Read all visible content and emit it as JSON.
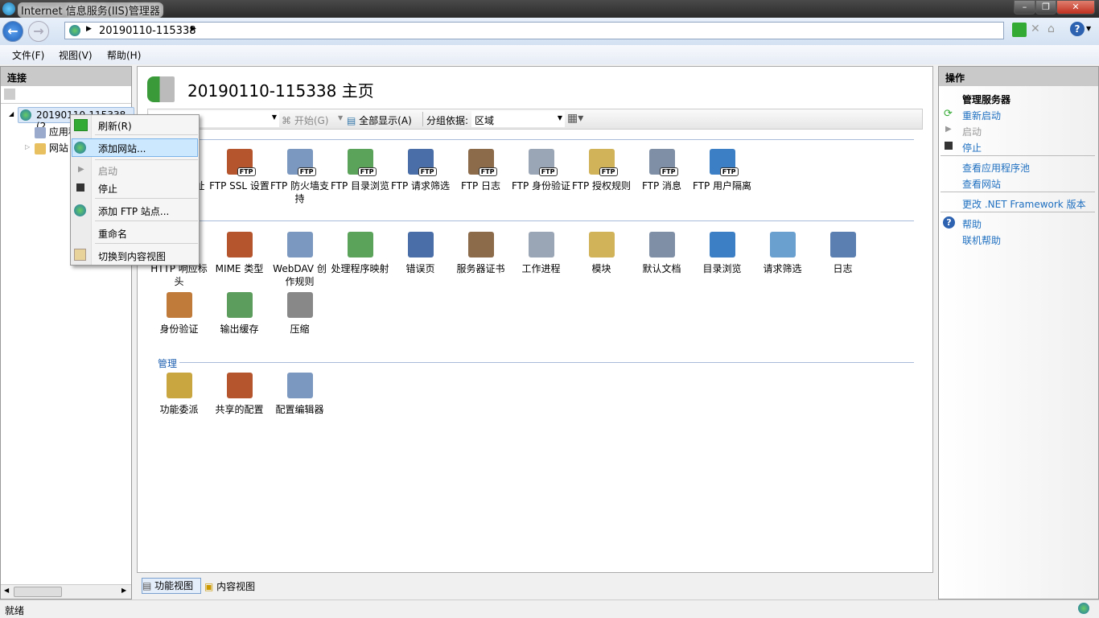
{
  "window": {
    "title": "Internet 信息服务(IIS)管理器"
  },
  "address": {
    "crumb": "20190110-115338"
  },
  "menu": [
    "文件(F)",
    "视图(V)",
    "帮助(H)"
  ],
  "left": {
    "header": "连接",
    "tree": {
      "root": "20190110-115338 (2",
      "children": [
        "应用程序池",
        "网站"
      ]
    }
  },
  "context_menu": {
    "items": [
      "刷新(R)",
      "添加网站...",
      "启动",
      "停止",
      "添加 FTP 站点...",
      "重命名",
      "切换到内容视图"
    ],
    "highlighted": "添加网站...",
    "disabled": [
      "启动"
    ]
  },
  "center": {
    "title": "20190110-115338 主页",
    "toolbar": {
      "filter_value": "",
      "start": "开始(G)",
      "show_all": "全部显示(A)",
      "group_by_label": "分组依据:",
      "group_by_value": "区域"
    },
    "groups": [
      {
        "name": "管理",
        "items": [
          "功能委派",
          "共享的配置",
          "配置编辑器"
        ]
      }
    ],
    "ftp_items": [
      "FTP IP 地址和域限制",
      "FTP SSL 设置",
      "FTP 防火墙支持",
      "FTP 目录浏览",
      "FTP 请求筛选",
      "FTP 日志",
      "FTP 身份验证",
      "FTP 授权规则",
      "FTP 消息",
      "FTP 用户隔离"
    ],
    "iis_items": [
      "HTTP 响应标头",
      "MIME 类型",
      "WebDAV 创作规则",
      "处理程序映射",
      "错误页",
      "服务器证书",
      "工作进程",
      "模块",
      "默认文档",
      "目录浏览",
      "请求筛选",
      "日志",
      "身份验证",
      "输出缓存",
      "压缩"
    ],
    "ftp_badge": "FTP",
    "view_tabs": [
      "功能视图",
      "内容视图"
    ]
  },
  "right": {
    "header": "操作",
    "section": "管理服务器",
    "actions": [
      "重新启动",
      "启动",
      "停止",
      "查看应用程序池",
      "查看网站",
      "更改 .NET Framework 版本",
      "帮助",
      "联机帮助"
    ]
  },
  "status": {
    "text": "就绪"
  },
  "colors": {
    "link": "#1e6fc0",
    "highlight": "#cce8ff"
  }
}
